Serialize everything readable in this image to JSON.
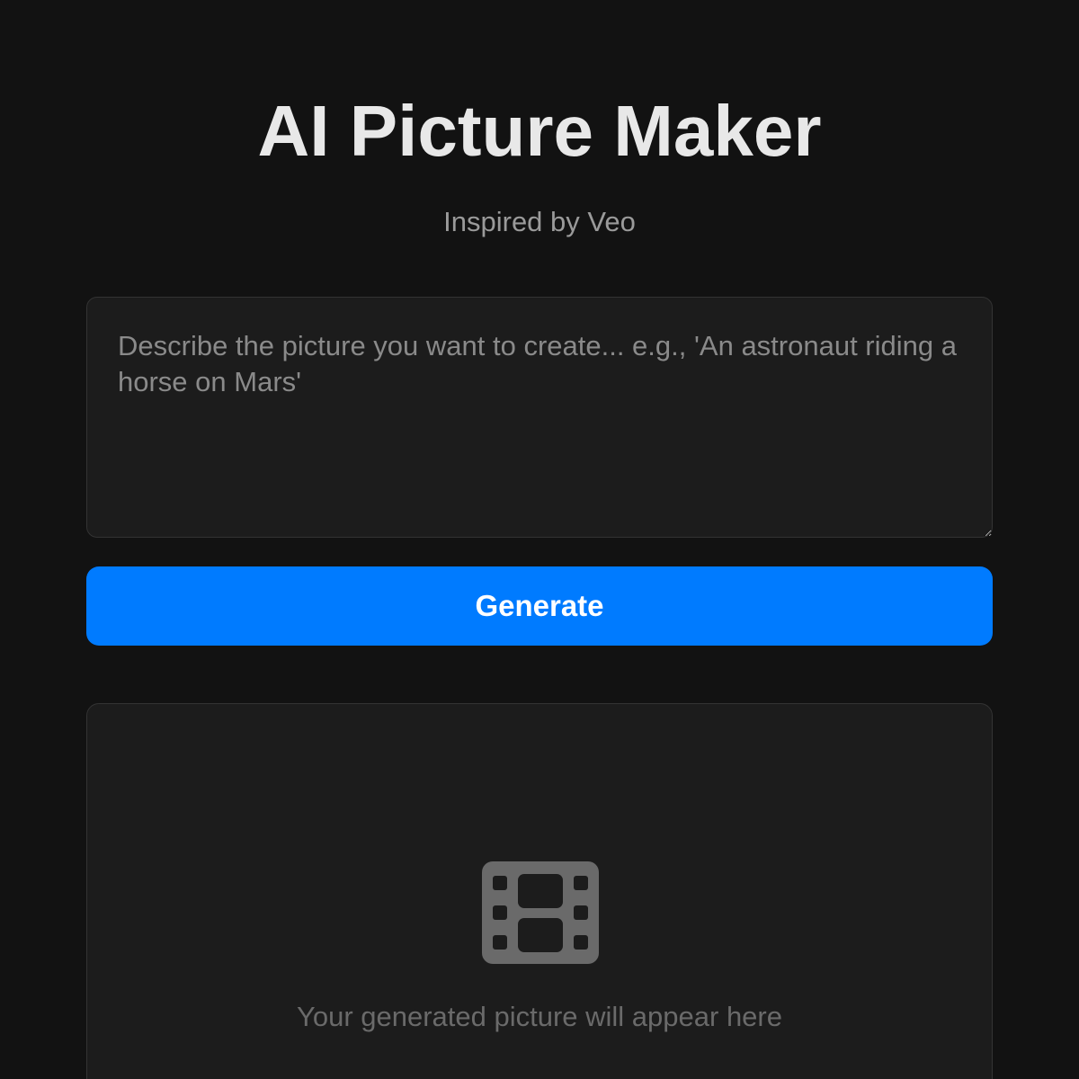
{
  "header": {
    "title": "AI Picture Maker",
    "subtitle": "Inspired by Veo"
  },
  "prompt": {
    "value": "",
    "placeholder": "Describe the picture you want to create... e.g., 'An astronaut riding a horse on Mars'"
  },
  "actions": {
    "generate_label": "Generate"
  },
  "preview": {
    "icon": "film-icon",
    "placeholder_text": "Your generated picture will appear here"
  },
  "colors": {
    "background": "#121212",
    "panel": "#1c1c1c",
    "accent": "#007bff",
    "icon": "#6a6a6a"
  }
}
